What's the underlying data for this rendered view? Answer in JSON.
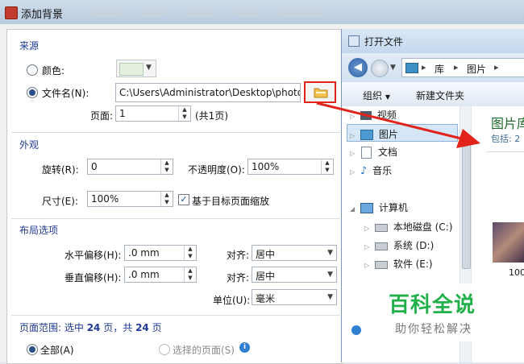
{
  "dialog": {
    "title": "添加背景",
    "source_section": "来源",
    "color_label": "颜色:",
    "filename_label": "文件名(N):",
    "filename_value": "C:\\Users\\Administrator\\Desktop\\photo",
    "page_label": "页面:",
    "page_value": "1",
    "page_total": "(共1页)",
    "appearance_section": "外观",
    "rotation_label": "旋转(R):",
    "rotation_value": "0",
    "opacity_label": "不透明度(O):",
    "opacity_value": "100%",
    "size_label": "尺寸(E):",
    "size_value": "100%",
    "scale_label": "基于目标页面缩放",
    "layout_section": "布局选项",
    "h_offset_label": "水平偏移(H):",
    "h_offset_value": ".0 mm",
    "v_offset_label": "垂直偏移(H):",
    "v_offset_value": ".0 mm",
    "align_label": "对齐:",
    "align_h_value": "居中",
    "align_v_value": "居中",
    "unit_label": "单位(U):",
    "unit_value": "毫米",
    "page_range_prefix": "页面范围: 选中",
    "page_range_selected": "24",
    "page_range_mid": "页，共",
    "page_range_total": "24",
    "page_range_suffix": "页",
    "all_label": "全部(A)",
    "selected_pages_label": "选择的页面(S)"
  },
  "explorer": {
    "title": "打开文件",
    "breadcrumb": [
      "库",
      "图片"
    ],
    "organize_label": "组织",
    "new_folder_label": "新建文件夹",
    "tree": [
      {
        "label": "视频",
        "icon": "video-icon"
      },
      {
        "label": "图片",
        "icon": "pictures-icon"
      },
      {
        "label": "文档",
        "icon": "documents-icon"
      },
      {
        "label": "音乐",
        "icon": "music-icon"
      },
      {
        "label": "计算机",
        "icon": "computer-icon"
      },
      {
        "label": "本地磁盘 (C:)",
        "icon": "drive-icon"
      },
      {
        "label": "系统 (D:)",
        "icon": "drive-icon"
      },
      {
        "label": "软件 (E:)",
        "icon": "drive-icon"
      }
    ],
    "library_title": "图片库",
    "library_includes": "包括: 2",
    "thumb_caption": "100"
  },
  "watermark": {
    "title": "百科全说",
    "subtitle": "助你轻松解决"
  },
  "colors": {
    "section_title": "#1f3a93",
    "arrow": "#e2231a",
    "highlight": "#e2231a",
    "watermark_green": "#22b04a"
  }
}
